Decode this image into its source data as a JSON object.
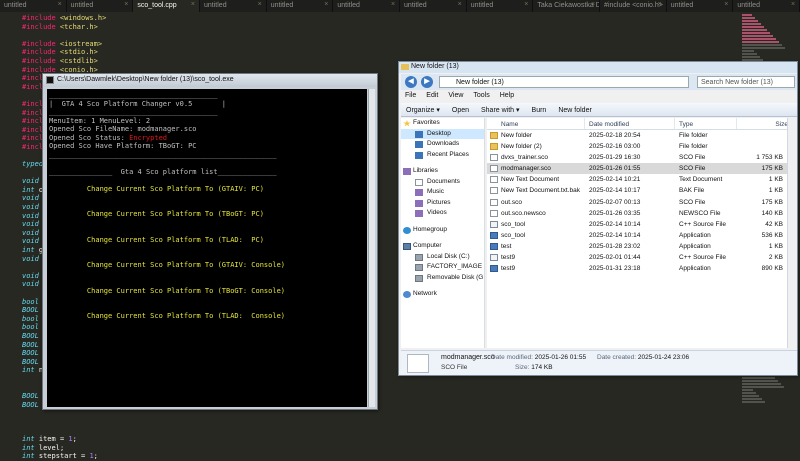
{
  "editor": {
    "tabs": [
      {
        "label": "untitled",
        "active": false
      },
      {
        "label": "untitled",
        "active": false
      },
      {
        "label": "sco_tool.cpp",
        "active": true
      },
      {
        "label": "untitled",
        "active": false
      },
      {
        "label": "untitled",
        "active": false
      },
      {
        "label": "untitled",
        "active": false
      },
      {
        "label": "untitled",
        "active": false
      },
      {
        "label": "untitled",
        "active": false
      },
      {
        "label": "Taka Ciekawostka Dla Moich Fanów",
        "active": false
      },
      {
        "label": "#include <conio.h>",
        "active": false
      },
      {
        "label": "untitled",
        "active": false
      },
      {
        "label": "untitled",
        "active": false
      }
    ],
    "lines": [
      {
        "pp": "#include",
        "rest": " <windows.h>"
      },
      {
        "pp": "#include",
        "rest": " <tchar.h>"
      },
      {
        "pp": "",
        "rest": ""
      },
      {
        "pp": "#include",
        "rest": " <iostream>"
      },
      {
        "pp": "#include",
        "rest": " <stdio.h>"
      },
      {
        "pp": "#include",
        "rest": " <cstdlib>"
      },
      {
        "pp": "#include",
        "rest": " <conio.h>"
      },
      {
        "pp": "#include",
        "rest": " <fstream>"
      },
      {
        "pp": "#include",
        "rest": ""
      },
      {
        "pp": "",
        "rest": ""
      },
      {
        "pp": "#include",
        "rest": ""
      },
      {
        "pp": "#include",
        "rest": ""
      },
      {
        "pp": "#include",
        "rest": ""
      },
      {
        "pp": "#include",
        "rest": ""
      },
      {
        "pp": "#include",
        "rest": ""
      },
      {
        "pp": "#include",
        "rest": ""
      },
      {
        "pp": "",
        "rest": ""
      },
      {
        "kw": "typede",
        "rest": ""
      },
      {
        "pp": "",
        "rest": ""
      },
      {
        "kw": "void",
        "rest": " i"
      },
      {
        "kw": "int",
        "rest": " op"
      },
      {
        "kw": "void",
        "rest": " s"
      },
      {
        "kw": "void",
        "rest": " r"
      },
      {
        "kw": "void",
        "rest": " E"
      },
      {
        "kw": "void",
        "rest": " i"
      },
      {
        "kw": "void",
        "rest": " c"
      },
      {
        "kw": "void",
        "rest": " u"
      },
      {
        "kw": "int",
        "rest": " ge"
      },
      {
        "kw": "void",
        "rest": " p"
      },
      {
        "pp": "",
        "rest": ""
      },
      {
        "kw": "void",
        "rest": " n"
      },
      {
        "kw": "void",
        "rest": " m"
      },
      {
        "pp": "",
        "rest": ""
      },
      {
        "kw": "bool",
        "rest": " S"
      },
      {
        "kw": "BOOL",
        "rest": " B"
      },
      {
        "kw": "bool",
        "rest": " s"
      },
      {
        "kw": "bool",
        "rest": " s"
      },
      {
        "kw": "BOOL",
        "rest": " A"
      },
      {
        "kw": "BOOL",
        "rest": " f"
      },
      {
        "kw": "BOOL",
        "rest": " f"
      },
      {
        "kw": "BOOL",
        "rest": " n"
      },
      {
        "kw": "int",
        "rest": " ne"
      },
      {
        "pp": "",
        "rest": ""
      },
      {
        "pp": "",
        "rest": ""
      },
      {
        "kw": "BOOL",
        "rest": " E"
      },
      {
        "kw": "BOOL",
        "rest": " e"
      },
      {
        "pp": "",
        "rest": ""
      },
      {
        "pp": "",
        "rest": ""
      },
      {
        "pp": "",
        "rest": ""
      },
      {
        "kw": "int",
        "rest": " item = ",
        "num": "1",
        "end": ";"
      },
      {
        "kw": "int",
        "rest": " level;"
      },
      {
        "kw": "int",
        "rest": " stepstart = ",
        "num": "1",
        "end": ";"
      }
    ]
  },
  "console": {
    "title": "C:\\Users\\Dawmlek\\Desktop\\New folder (13)\\sco_tool.exe",
    "header_line": "|  GTA 4 Sco Platform Changer v0.5       |",
    "menu_line": "MenuItem: 1 MenuLevel: 2",
    "opened_file": "Opened Sco FileName: modmanager.sco",
    "status_label": "Opened Sco Status: ",
    "status_value": "Encrypted",
    "platform": "Opened Sco Have Platform: TBoGT: PC",
    "list_title": "Gta 4 Sco platform list",
    "options": [
      "Change Current Sco Platform To (GTAIV: PC)",
      "Change Current Sco Platform To (TBoGT: PC)",
      "Change Current Sco Platform To (TLAD:  PC)",
      "Change Current Sco Platform To (GTAIV: Console)",
      "Change Current Sco Platform To (TBoGT: Console)",
      "Change Current Sco Platform To (TLAD:  Console)"
    ]
  },
  "explorer": {
    "title": "New folder (13)",
    "address": "New folder (13)",
    "search_placeholder": "Search New folder (13)",
    "menu": [
      "File",
      "Edit",
      "View",
      "Tools",
      "Help"
    ],
    "toolbar": [
      "Organize ▾",
      "Open",
      "Share with ▾",
      "Burn",
      "New folder"
    ],
    "nav": [
      {
        "label": "Favorites",
        "icon": "star-icon",
        "group": true
      },
      {
        "label": "Desktop",
        "icon": "desktop-icon",
        "selected": true
      },
      {
        "label": "Downloads",
        "icon": "downloads-icon"
      },
      {
        "label": "Recent Places",
        "icon": "recent-places-icon"
      },
      {
        "gap": true
      },
      {
        "label": "Libraries",
        "icon": "libraries-icon",
        "group": true
      },
      {
        "label": "Documents",
        "icon": "documents-icon"
      },
      {
        "label": "Music",
        "icon": "music-icon"
      },
      {
        "label": "Pictures",
        "icon": "pictures-icon"
      },
      {
        "label": "Videos",
        "icon": "videos-icon"
      },
      {
        "gap": true
      },
      {
        "label": "Homegroup",
        "icon": "homegroup-icon",
        "group": true
      },
      {
        "gap": true
      },
      {
        "label": "Computer",
        "icon": "computer-icon",
        "group": true
      },
      {
        "label": "Local Disk (C:)",
        "icon": "drive-icon"
      },
      {
        "label": "FACTORY_IMAGE (D:",
        "icon": "drive-icon"
      },
      {
        "label": "Removable Disk (G:)",
        "icon": "removable-drive-icon"
      },
      {
        "gap": true
      },
      {
        "label": "Network",
        "icon": "network-icon",
        "group": true
      }
    ],
    "columns": [
      "Name",
      "Date modified",
      "Type",
      "Size"
    ],
    "files": [
      {
        "name": "New folder",
        "date": "2025-02-18 20:54",
        "type": "File folder",
        "size": "",
        "icon": "folder"
      },
      {
        "name": "New folder (2)",
        "date": "2025-02-16 03:00",
        "type": "File folder",
        "size": "",
        "icon": "folder"
      },
      {
        "name": "dvxs_trainer.sco",
        "date": "2025-01-29 16:30",
        "type": "SCO File",
        "size": "1 753 KB",
        "icon": "file"
      },
      {
        "name": "modmanager.sco",
        "date": "2025-01-26 01:55",
        "type": "SCO File",
        "size": "175 KB",
        "icon": "file",
        "selected": true
      },
      {
        "name": "New Text Document",
        "date": "2025-02-14 10:21",
        "type": "Text Document",
        "size": "1 KB",
        "icon": "file"
      },
      {
        "name": "New Text Document.txt.bak",
        "date": "2025-02-14 10:17",
        "type": "BAK File",
        "size": "1 KB",
        "icon": "file"
      },
      {
        "name": "out.sco",
        "date": "2025-02-07 00:13",
        "type": "SCO File",
        "size": "175 KB",
        "icon": "file"
      },
      {
        "name": "out.sco.newsco",
        "date": "2025-01-26 03:35",
        "type": "NEWSCO File",
        "size": "140 KB",
        "icon": "file"
      },
      {
        "name": "sco_tool",
        "date": "2025-02-14 10:14",
        "type": "C++ Source File",
        "size": "42 KB",
        "icon": "cpp"
      },
      {
        "name": "sco_tool",
        "date": "2025-02-14 10:14",
        "type": "Application",
        "size": "536 KB",
        "icon": "app"
      },
      {
        "name": "test",
        "date": "2025-01-28 23:02",
        "type": "Application",
        "size": "1 KB",
        "icon": "app"
      },
      {
        "name": "test9",
        "date": "2025-02-01 01:44",
        "type": "C++ Source File",
        "size": "2 KB",
        "icon": "cpp"
      },
      {
        "name": "test9",
        "date": "2025-01-31 23:18",
        "type": "Application",
        "size": "890 KB",
        "icon": "app"
      }
    ],
    "details": {
      "filename": "modmanager.sco",
      "filetype": "SCO File",
      "date_modified_label": "Date modified:",
      "date_modified": "2025-01-26 01:55",
      "size_label": "Size:",
      "size": "174 KB",
      "date_created_label": "Date created:",
      "date_created": "2025-01-24 23:06"
    }
  }
}
